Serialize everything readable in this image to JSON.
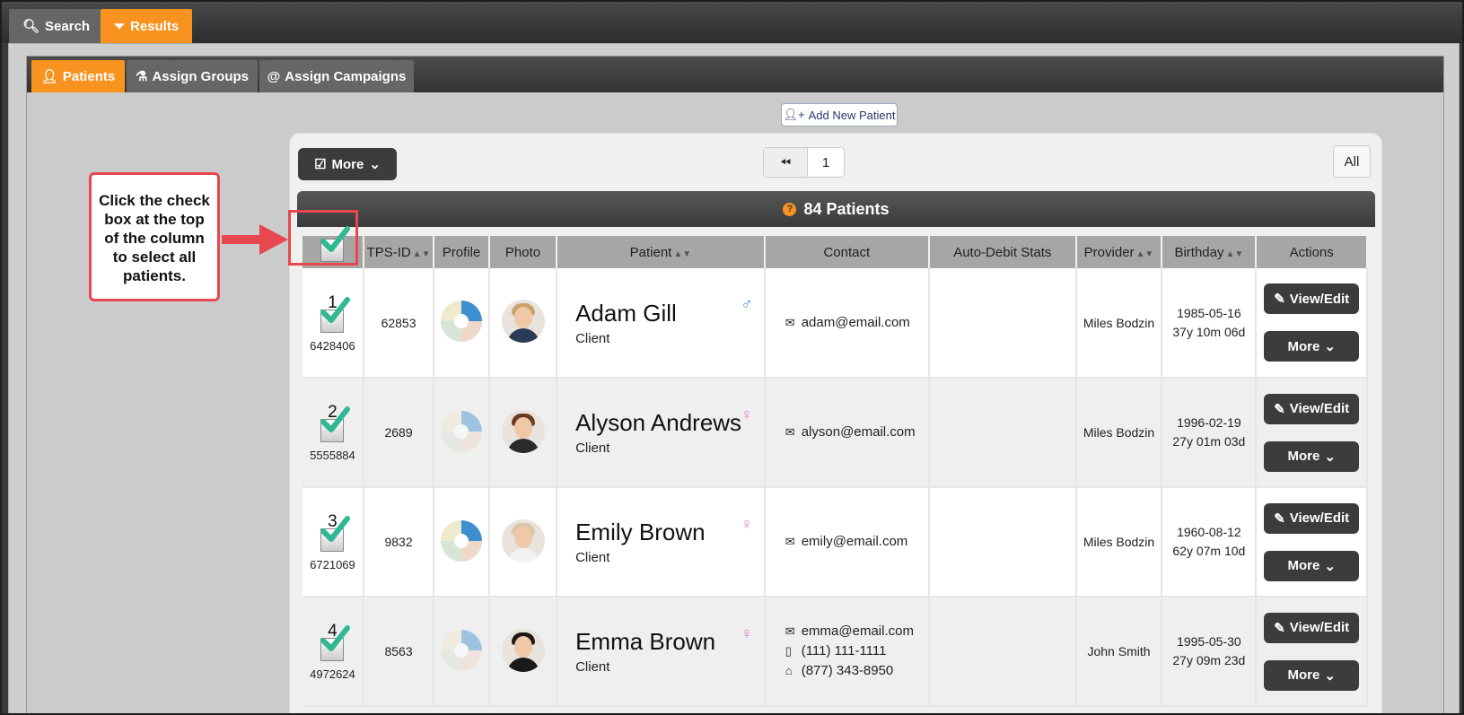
{
  "top_tabs": {
    "search": "Search",
    "results": "Results"
  },
  "sub_tabs": {
    "patients": "Patients",
    "groups": "Assign Groups",
    "campaigns": "Assign Campaigns"
  },
  "toolbar": {
    "add_new_patient": "Add New Patient",
    "more": "More",
    "page_current": "1",
    "all": "All"
  },
  "summary": {
    "text": "84 Patients"
  },
  "columns": {
    "tps_id": "TPS-ID",
    "profile": "Profile",
    "photo": "Photo",
    "patient": "Patient",
    "contact": "Contact",
    "auto_debit": "Auto-Debit Stats",
    "provider": "Provider",
    "birthday": "Birthday",
    "actions": "Actions"
  },
  "rows": [
    {
      "num": "1",
      "code": "6428406",
      "tps_id": "62853",
      "name": "Adam Gill",
      "type": "Client",
      "gender": "♂",
      "email": "adam@email.com",
      "phone1": "",
      "phone2": "",
      "provider": "Miles Bodzin",
      "birthday": "1985-05-16",
      "age": "37y 10m 06d"
    },
    {
      "num": "2",
      "code": "5555884",
      "tps_id": "2689",
      "name": "Alyson Andrews",
      "type": "Client",
      "gender": "♀",
      "email": "alyson@email.com",
      "phone1": "",
      "phone2": "",
      "provider": "Miles Bodzin",
      "birthday": "1996-02-19",
      "age": "27y 01m 03d"
    },
    {
      "num": "3",
      "code": "6721069",
      "tps_id": "9832",
      "name": "Emily Brown",
      "type": "Client",
      "gender": "♀",
      "email": "emily@email.com",
      "phone1": "",
      "phone2": "",
      "provider": "Miles Bodzin",
      "birthday": "1960-08-12",
      "age": "62y 07m 10d"
    },
    {
      "num": "4",
      "code": "4972624",
      "tps_id": "8563",
      "name": "Emma Brown",
      "type": "Client",
      "gender": "♀",
      "email": "emma@email.com",
      "phone1": "(111) 111-1111",
      "phone2": "(877) 343-8950",
      "provider": "John Smith",
      "birthday": "1995-05-30",
      "age": "27y 09m 23d"
    }
  ],
  "row_actions": {
    "view_edit": "View/Edit",
    "more": "More"
  },
  "callout": {
    "text": "Click the check box at the top of the column to select all patients."
  },
  "colors": {
    "accent": "#f7931e",
    "dark_button": "#3c3c3c",
    "checkmark": "#2fb894",
    "callout_border": "#e8474f"
  }
}
